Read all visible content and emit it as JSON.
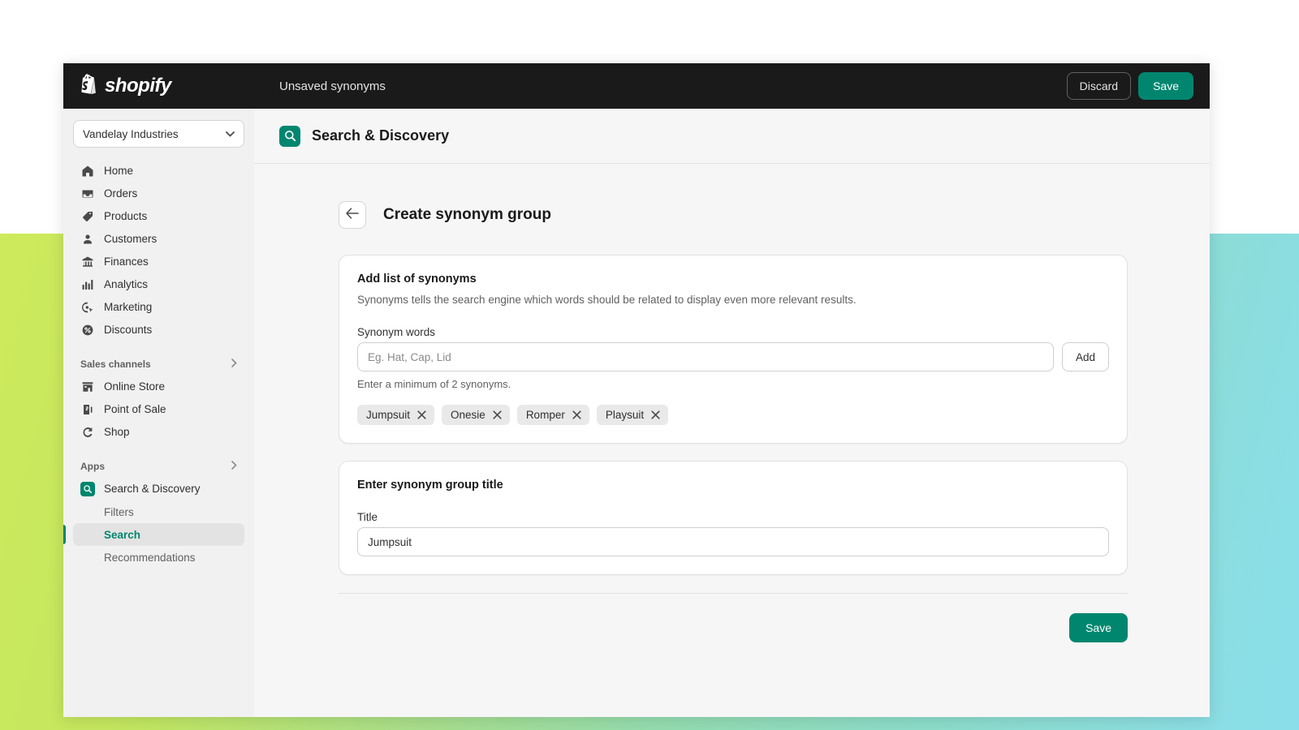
{
  "theme": {
    "accent_green": "#00866f",
    "topbar_bg": "#1a1a1a",
    "page_bg": "#f6f6f7",
    "sidebar_bg": "#f1f1f1",
    "gradient_left": "#cdea5c",
    "gradient_right": "#8adeeb"
  },
  "topbar": {
    "brand": "shopify",
    "title": "Unsaved synonyms",
    "discard_label": "Discard",
    "save_label": "Save"
  },
  "sidebar": {
    "store": "Vandelay Industries",
    "items": [
      {
        "label": "Home",
        "icon": "home-icon"
      },
      {
        "label": "Orders",
        "icon": "orders-icon"
      },
      {
        "label": "Products",
        "icon": "products-tag-icon"
      },
      {
        "label": "Customers",
        "icon": "customers-person-icon"
      },
      {
        "label": "Finances",
        "icon": "finances-bank-icon"
      },
      {
        "label": "Analytics",
        "icon": "analytics-bars-icon"
      },
      {
        "label": "Marketing",
        "icon": "marketing-target-icon"
      },
      {
        "label": "Discounts",
        "icon": "discounts-percent-icon"
      }
    ],
    "sales_channels": {
      "label": "Sales channels",
      "items": [
        {
          "label": "Online Store",
          "icon": "online-store-icon"
        },
        {
          "label": "Point of Sale",
          "icon": "point-of-sale-icon"
        },
        {
          "label": "Shop",
          "icon": "shop-icon"
        }
      ]
    },
    "apps": {
      "label": "Apps",
      "items": [
        {
          "label": "Search & Discovery",
          "icon": "search-discovery-app-icon"
        }
      ],
      "sub_items": [
        {
          "label": "Filters",
          "active": false
        },
        {
          "label": "Search",
          "active": true
        },
        {
          "label": "Recommendations",
          "active": false
        }
      ]
    }
  },
  "app_header": {
    "title": "Search & Discovery",
    "icon": "search-discovery-app-icon"
  },
  "page": {
    "title": "Create synonym group",
    "back_label": "←"
  },
  "synonyms_card": {
    "title": "Add list of synonyms",
    "description": "Synonyms tells the search engine which words should be related to display even more relevant results.",
    "field_label": "Synonym words",
    "input_value": "",
    "input_placeholder": "Eg. Hat, Cap, Lid",
    "add_label": "Add",
    "help_text": "Enter a minimum of 2 synonyms.",
    "chips": [
      {
        "label": "Jumpsuit"
      },
      {
        "label": "Onesie"
      },
      {
        "label": "Romper"
      },
      {
        "label": "Playsuit"
      }
    ]
  },
  "title_card": {
    "title": "Enter synonym group title",
    "field_label": "Title",
    "input_value": "Jumpsuit",
    "input_placeholder": ""
  },
  "footer": {
    "save_label": "Save"
  }
}
